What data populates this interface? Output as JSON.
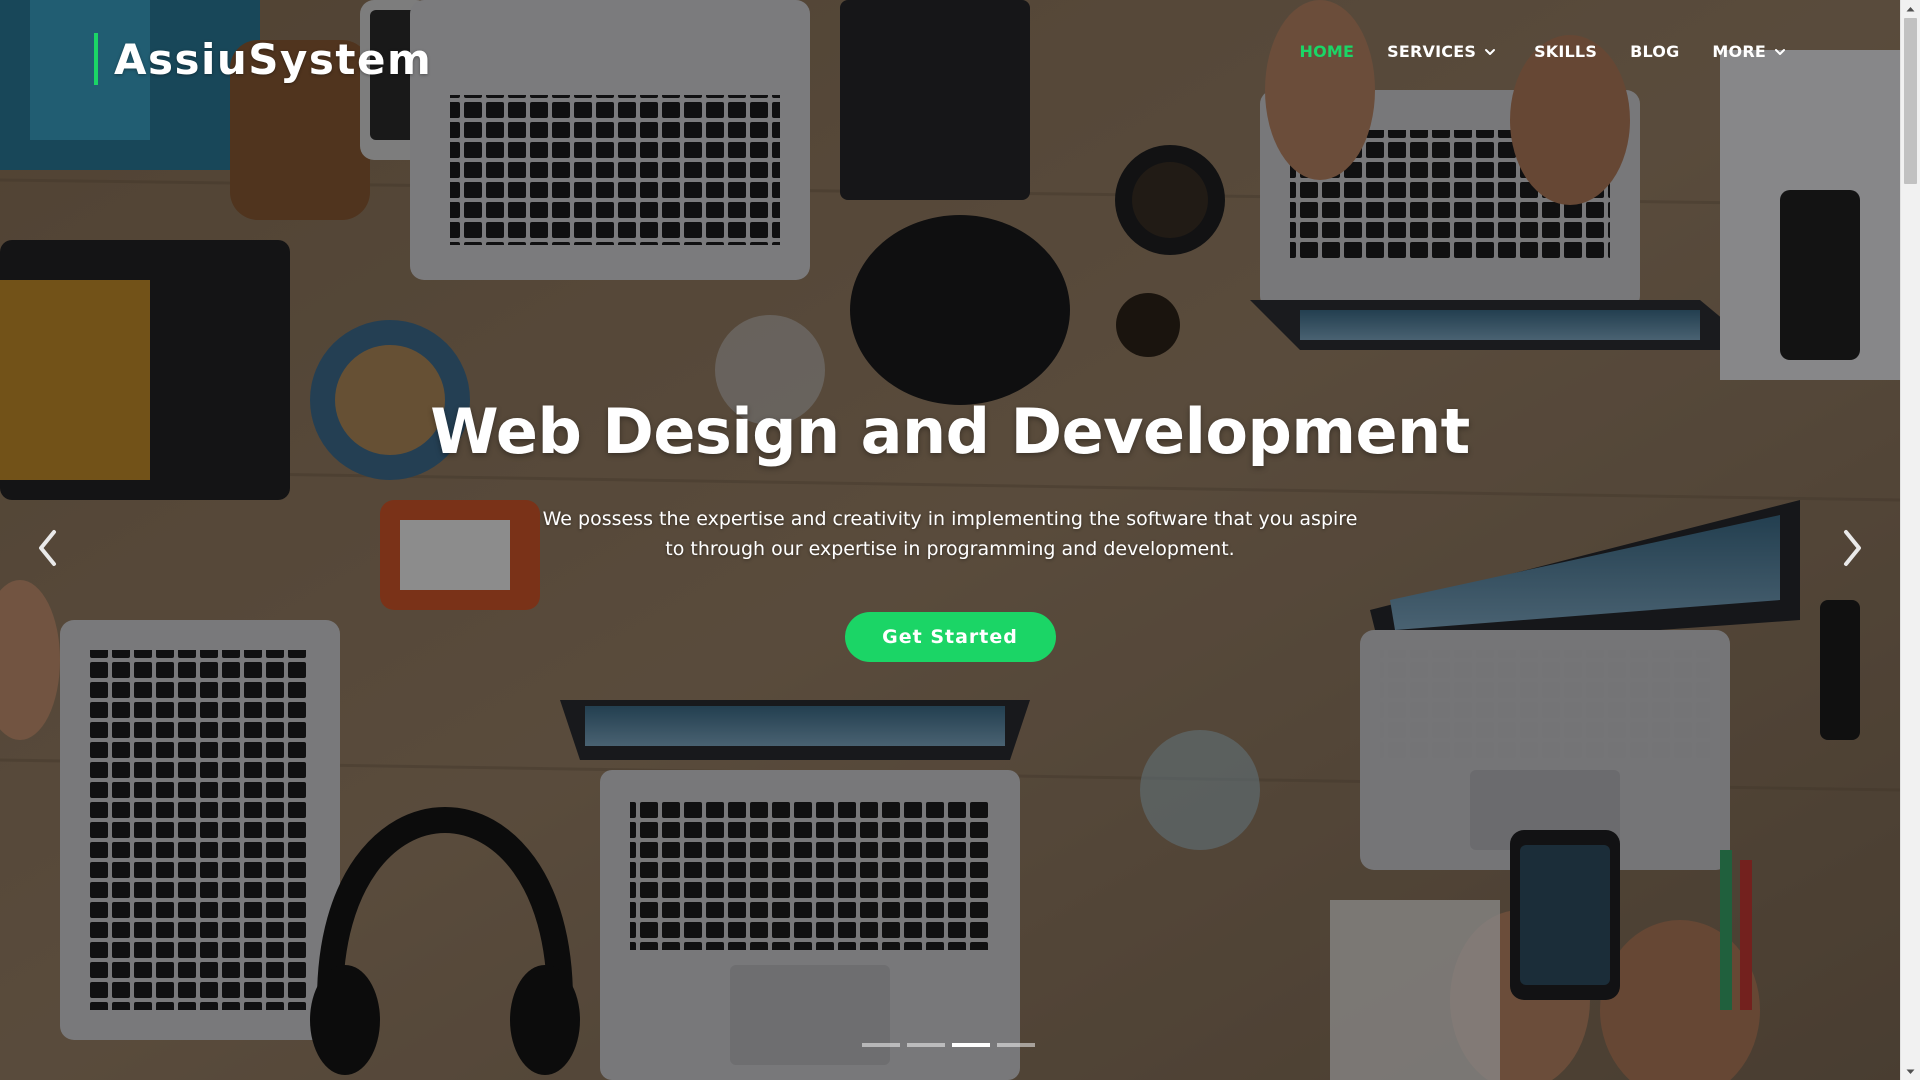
{
  "brand": {
    "name": "AssiuSystem",
    "accent_color": "#1bd566"
  },
  "nav": {
    "items": [
      {
        "label": "HOME",
        "active": true,
        "has_dropdown": false
      },
      {
        "label": "SERVICES",
        "active": false,
        "has_dropdown": true
      },
      {
        "label": "SKILLS",
        "active": false,
        "has_dropdown": false
      },
      {
        "label": "BLOG",
        "active": false,
        "has_dropdown": false
      },
      {
        "label": "MORE",
        "active": false,
        "has_dropdown": true
      }
    ]
  },
  "hero": {
    "title": "Web Design and Development",
    "description": "We possess the expertise and creativity in implementing the software that you aspire to through our expertise in programming and development.",
    "cta_label": "Get Started",
    "background": "desk-with-laptops-photo"
  },
  "carousel": {
    "prev_icon": "chevron-left-icon",
    "next_icon": "chevron-right-icon",
    "slide_count": 4,
    "active_slide": 3
  },
  "scrollbar": {
    "up_icon": "scroll-up-arrow-icon",
    "down_icon": "scroll-down-arrow-icon"
  }
}
